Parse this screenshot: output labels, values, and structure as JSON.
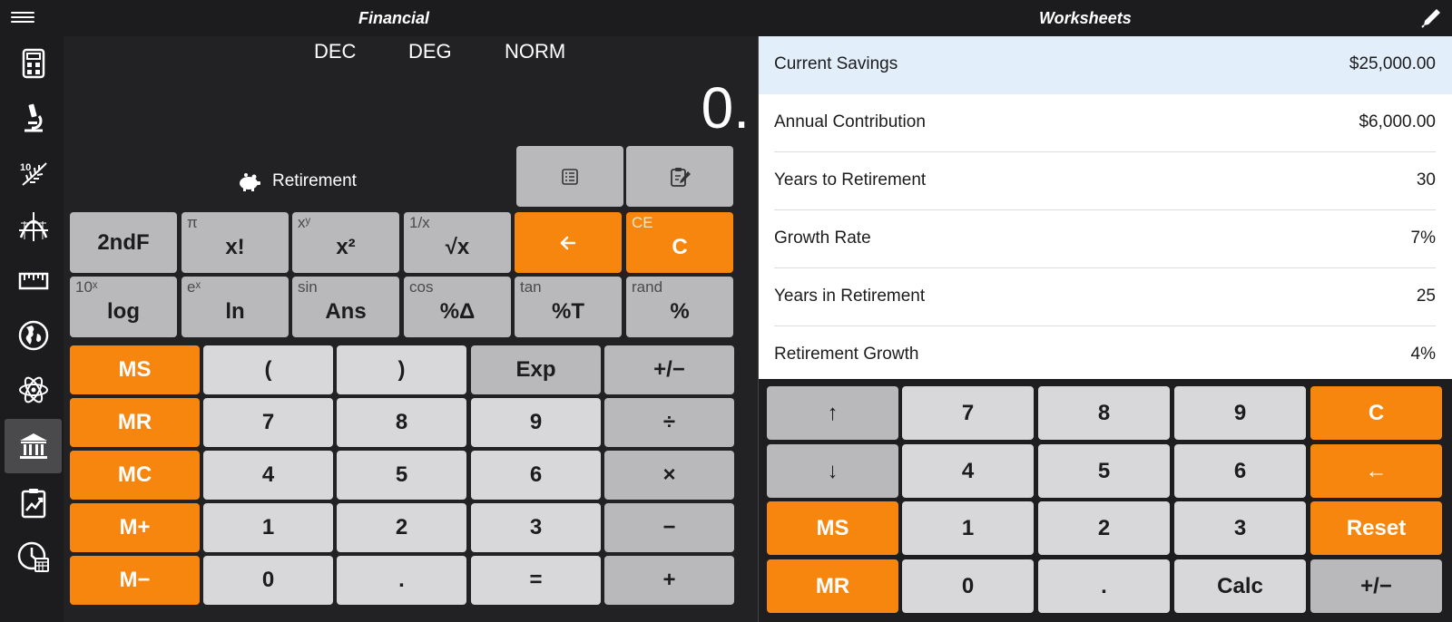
{
  "header": {
    "left_title": "Financial",
    "right_title": "Worksheets"
  },
  "sidebar": {
    "items": [
      {
        "icon": "calculator-icon"
      },
      {
        "icon": "microscope-icon"
      },
      {
        "icon": "fern-icon"
      },
      {
        "icon": "graph-icon"
      },
      {
        "icon": "ruler-icon"
      },
      {
        "icon": "globe-icon"
      },
      {
        "icon": "atom-icon"
      },
      {
        "icon": "bank-icon",
        "active": true
      },
      {
        "icon": "chart-clipboard-icon"
      },
      {
        "icon": "clock-calendar-icon"
      }
    ]
  },
  "calc": {
    "modes": [
      "DEC",
      "DEG",
      "NORM"
    ],
    "display": "0.",
    "worksheet_name": "Retirement",
    "sci_keys": [
      {
        "main": "2ndF",
        "sub": ""
      },
      {
        "main": "x!",
        "sub": "π"
      },
      {
        "main": "x²",
        "sub": "xʸ"
      },
      {
        "main": "√x",
        "sub": "1/x"
      },
      {
        "main": "",
        "sub": "",
        "icon": "backspace-icon"
      },
      {
        "main": "C",
        "sub": "CE"
      },
      {
        "main": "log",
        "sub": "10ˣ"
      },
      {
        "main": "ln",
        "sub": "eˣ"
      },
      {
        "main": "Ans",
        "sub": "sin"
      },
      {
        "main": "%Δ",
        "sub": "cos"
      },
      {
        "main": "%T",
        "sub": "tan"
      },
      {
        "main": "%",
        "sub": "rand"
      }
    ],
    "main_keys": [
      "MS",
      "(",
      ")",
      "Exp",
      "+/−",
      "MR",
      "7",
      "8",
      "9",
      "÷",
      "MC",
      "4",
      "5",
      "6",
      "×",
      "M+",
      "1",
      "2",
      "3",
      "−",
      "M−",
      "0",
      ".",
      "=",
      "+"
    ]
  },
  "worksheet": {
    "rows": [
      {
        "label": "Current Savings",
        "value": "$25,000.00"
      },
      {
        "label": "Annual Contribution",
        "value": "$6,000.00"
      },
      {
        "label": "Years to Retirement",
        "value": "30"
      },
      {
        "label": "Growth Rate",
        "value": "7%"
      },
      {
        "label": "Years in Retirement",
        "value": "25"
      },
      {
        "label": "Retirement Growth",
        "value": "4%"
      }
    ]
  },
  "pad": {
    "keys": [
      "↑",
      "7",
      "8",
      "9",
      "C",
      "↓",
      "4",
      "5",
      "6",
      "←",
      "MS",
      "1",
      "2",
      "3",
      "Reset",
      "MR",
      "0",
      ".",
      "Calc",
      "+/−"
    ]
  },
  "colors": {
    "orange": "#f7860f",
    "key": "#d8d8da",
    "key_dark": "#b9b9bb",
    "active_row": "#e2eefa"
  }
}
